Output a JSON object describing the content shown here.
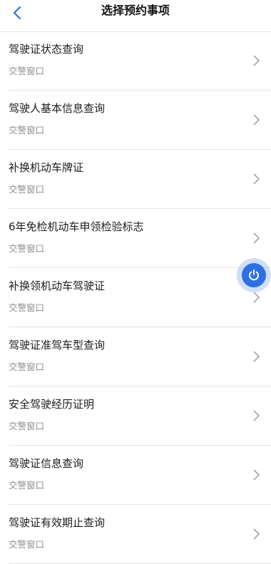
{
  "header": {
    "title": "选择预约事项",
    "back_icon": "chevron-left-icon"
  },
  "items": [
    {
      "title": "驾驶证状态查询",
      "subtitle": "交警窗口"
    },
    {
      "title": "驾驶人基本信息查询",
      "subtitle": "交警窗口"
    },
    {
      "title": "补换机动车牌证",
      "subtitle": "交警窗口"
    },
    {
      "title": "6年免检机动车申领检验标志",
      "subtitle": "交警窗口"
    },
    {
      "title": "补换领机动车驾驶证",
      "subtitle": "交警窗口"
    },
    {
      "title": "驾驶证准驾车型查询",
      "subtitle": "交警窗口"
    },
    {
      "title": "安全驾驶经历证明",
      "subtitle": "交警窗口"
    },
    {
      "title": "驾驶证信息查询",
      "subtitle": "交警窗口"
    },
    {
      "title": "驾驶证有效期止查询",
      "subtitle": "交警窗口"
    }
  ],
  "colors": {
    "accent": "#2f6fe4",
    "subtitle": "#8f8f8f",
    "divider": "#e3e3e3"
  },
  "floating_button": {
    "icon": "power-icon"
  }
}
